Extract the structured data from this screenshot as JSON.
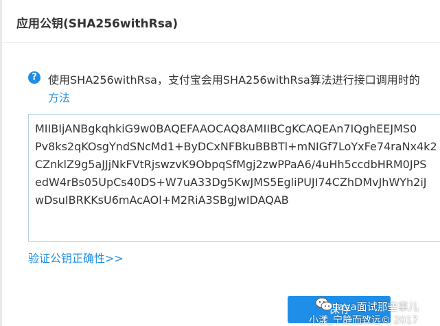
{
  "dialog": {
    "title": "应用公钥(SHA256withRsa)"
  },
  "info": {
    "icon": "question-icon",
    "line1": "使用SHA256withRsa，支付宝会用SHA256withRsa算法进行接口调用时的",
    "line2": "方法"
  },
  "public_key": {
    "lines": [
      "MIIBIjANBgkqhkiG9w0BAQEFAAOCAQ8AMIIBCgKCAQEAn7IQghEEJMS0",
      "Pv8ks2qKOsgYndSNcMd1+ByDCxNFBkuBBBTl+mNIGf7LoYxFe74raNx4k2",
      "CZnklZ9g5aJJjNkFVtRjswzvK9ObpqSfMgj2zwPPaA6/4uHh5ccdbHRM0JPS",
      "edW4rBs05UpCs40DS+W7uA33Dg5KwJMS5EgliPUJI74CZhDMvJhWYh2iJ",
      "wDsuIBRKKsU6mAcAOl+M2RiA3SBgJwIDAQAB"
    ]
  },
  "links": {
    "verify": "验证公钥正确性>>"
  },
  "buttons": {
    "save": "保存"
  },
  "watermark": {
    "line1": "Java面试那些事儿",
    "line2": "小漾_宁静而致远© 2017"
  },
  "colors": {
    "accent": "#1f8ee8",
    "text": "#333333",
    "border": "#b4cfe8"
  }
}
